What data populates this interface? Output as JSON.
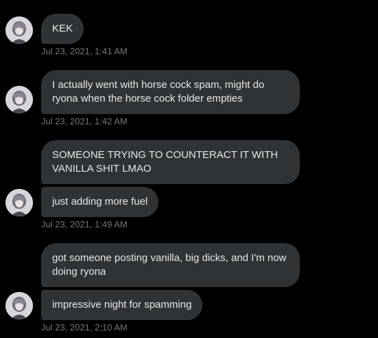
{
  "messages": [
    {
      "text": "KEK",
      "timestamp": "Jul 23, 2021, 1:41 AM"
    },
    {
      "text": "I actually went with horse cock spam, might do ryona when the horse cock folder empties",
      "timestamp": "Jul 23, 2021, 1:42 AM"
    },
    {
      "text": "SOMEONE TRYING TO COUNTERACT IT WITH VANILLA SHIT LMAO"
    },
    {
      "text": "just adding more fuel",
      "timestamp": "Jul 23, 2021, 1:49 AM"
    },
    {
      "text": "got someone posting vanilla, big dicks, and I'm now doing ryona"
    },
    {
      "text": "impressive night for spamming",
      "timestamp": "Jul 23, 2021, 2:10 AM"
    }
  ],
  "colors": {
    "background": "#000000",
    "bubble": "#2f3336",
    "text": "#e7e9ea",
    "timestamp": "#71767b"
  }
}
